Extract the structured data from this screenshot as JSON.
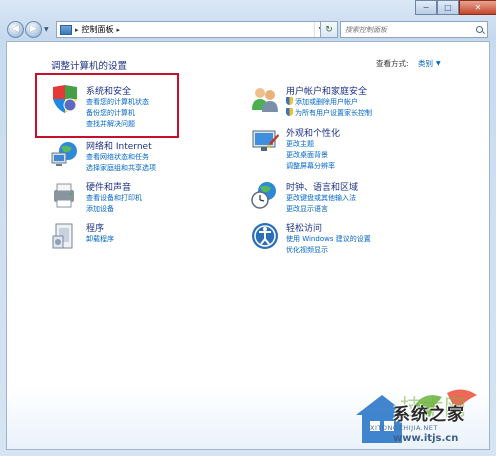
{
  "address_bar": {
    "path": "控制面板",
    "search_placeholder": "搜索控制面板"
  },
  "window_controls": {
    "minimize": "−",
    "maximize": "□",
    "close": "✕"
  },
  "main": {
    "heading": "调整计算机的设置",
    "view_by_label": "查看方式:",
    "view_by_value": "类别"
  },
  "categories": [
    {
      "icon": "system-security-icon",
      "title": "系统和安全",
      "links": [
        "查看您的计算机状态",
        "备份您的计算机",
        "查找并解决问题"
      ]
    },
    {
      "icon": "user-accounts-icon",
      "title": "用户帐户和家庭安全",
      "links": [
        "添加或删除用户帐户",
        "为所有用户设置家长控制"
      ]
    },
    {
      "icon": "network-icon",
      "title": "网络和 Internet",
      "links": [
        "查看网络状态和任务",
        "选择家庭组和共享选项"
      ]
    },
    {
      "icon": "appearance-icon",
      "title": "外观和个性化",
      "links": [
        "更改主题",
        "更改桌面背景",
        "调整屏幕分辨率"
      ]
    },
    {
      "icon": "hardware-sound-icon",
      "title": "硬件和声音",
      "links": [
        "查看设备和打印机",
        "添加设备"
      ]
    },
    {
      "icon": "clock-language-icon",
      "title": "时钟、语言和区域",
      "links": [
        "更改键盘或其他输入法",
        "更改显示语言"
      ]
    },
    {
      "icon": "programs-icon",
      "title": "程序",
      "links": [
        "卸载程序"
      ]
    },
    {
      "icon": "ease-of-access-icon",
      "title": "轻松访问",
      "links": [
        "使用 Windows 建议的设置",
        "优化视频显示"
      ]
    }
  ],
  "watermark": {
    "name": "系统之家",
    "pinyin": "XITONGZHIJIA.NET",
    "url": "www.itjs.cn"
  }
}
